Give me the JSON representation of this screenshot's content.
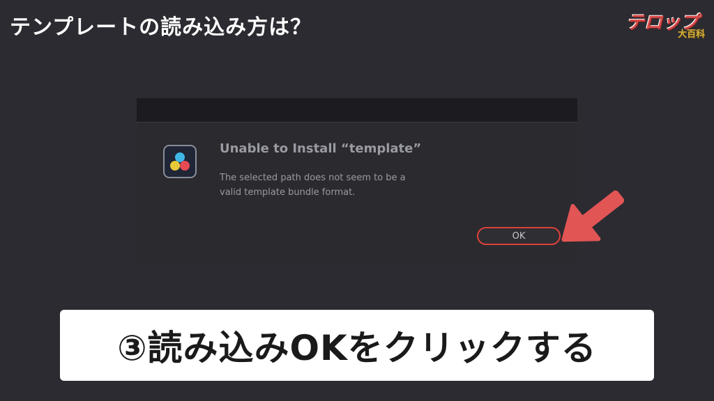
{
  "header": {
    "title": "テンプレートの読み込み方は？"
  },
  "logo": {
    "main": "テロップ",
    "sub": "大百科"
  },
  "dialog": {
    "heading": "Unable to Install “template”",
    "message": "The selected path does not seem to be a valid template bundle format.",
    "ok_label": "OK"
  },
  "caption": {
    "text": "③読み込みOKをクリックする"
  },
  "colors": {
    "background": "#2b2b31",
    "highlight": "#e0403a",
    "arrow": "#e25555",
    "caption_bg": "#ffffff"
  },
  "icons": {
    "app": "davinci-resolve-icon",
    "pointer": "arrow-pointer-icon"
  }
}
